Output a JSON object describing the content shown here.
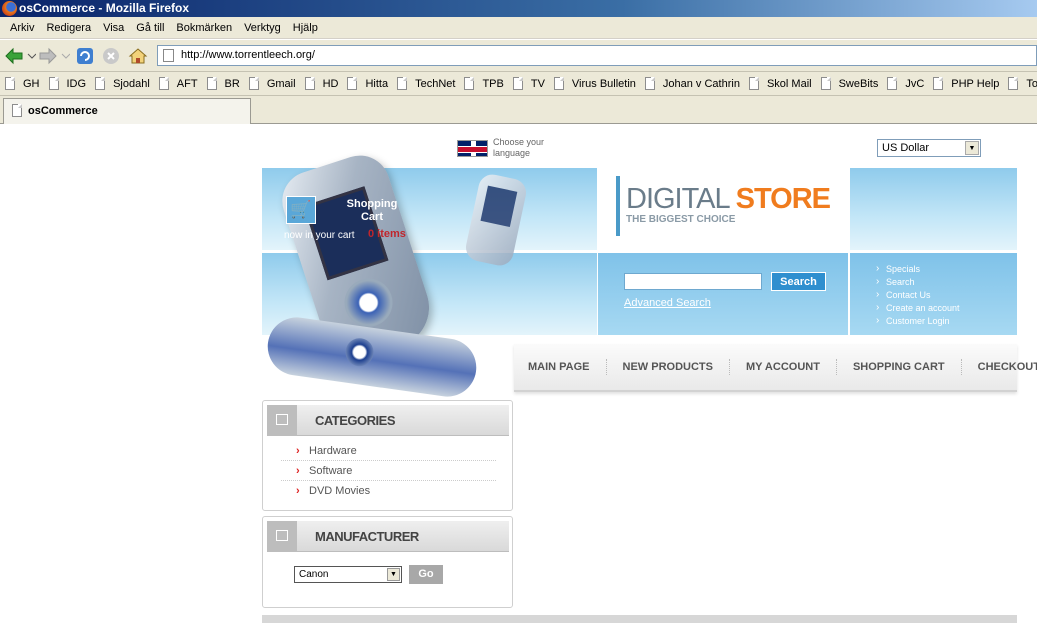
{
  "window": {
    "title": "osCommerce - Mozilla Firefox"
  },
  "menu": [
    "Arkiv",
    "Redigera",
    "Visa",
    "Gå till",
    "Bokmärken",
    "Verktyg",
    "Hjälp"
  ],
  "address": {
    "url": "http://www.torrentleech.org/"
  },
  "bookmarks": [
    "GH",
    "IDG",
    "Sjodahl",
    "AFT",
    "BR",
    "Gmail",
    "HD",
    "Hitta",
    "TechNet",
    "TPB",
    "TV",
    "Virus Bulletin",
    "Johan v Cathrin",
    "Skol Mail",
    "SweBits",
    "JvC",
    "PHP Help",
    "To"
  ],
  "tab": {
    "label": "osCommerce"
  },
  "store": {
    "language_text": "Choose your language",
    "currency": "US Dollar",
    "logo_main": "DIGITAL ",
    "logo_accent": "STORE",
    "logo_sub": "THE BIGGEST CHOICE",
    "cart_title": "Shopping Cart",
    "cart_now": "now in your cart",
    "cart_items": "0 items",
    "search_button": "Search",
    "advanced_search": "Advanced Search",
    "side_links": [
      "Specials",
      "Search",
      "Contact Us",
      "Create an account",
      "Customer Login"
    ],
    "nav": [
      "MAIN PAGE",
      "NEW PRODUCTS",
      "MY ACCOUNT",
      "SHOPPING CART",
      "CHECKOUT"
    ],
    "categories_title": "CATEGORIES",
    "categories": [
      "Hardware",
      "Software",
      "DVD Movies"
    ],
    "manufacturer_title": "MANUFACTURER",
    "manufacturer_selected": "Canon",
    "go_button": "Go"
  }
}
